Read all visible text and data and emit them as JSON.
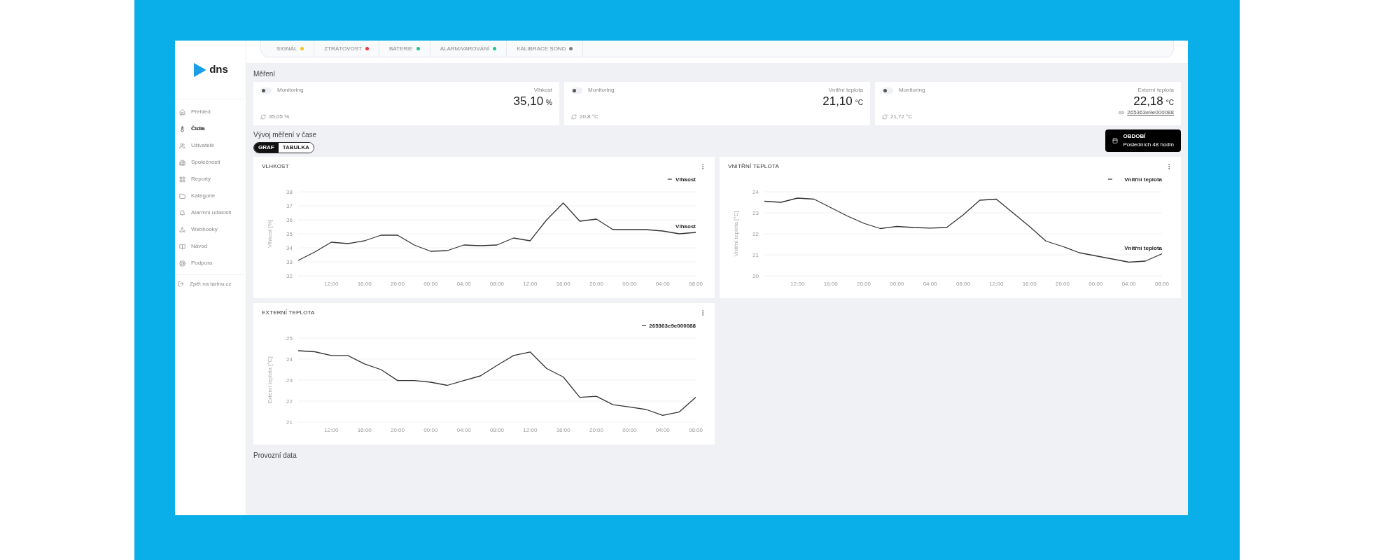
{
  "logo": {
    "text": "dns"
  },
  "sidebar": {
    "items": [
      {
        "label": "Přehled",
        "selected": false
      },
      {
        "label": "Čidla",
        "selected": true
      },
      {
        "label": "Uživatelé",
        "selected": false
      },
      {
        "label": "Společnosti",
        "selected": false
      },
      {
        "label": "Reporty",
        "selected": false
      },
      {
        "label": "Kategorie",
        "selected": false
      },
      {
        "label": "Alarmní události",
        "selected": false
      },
      {
        "label": "Webhooky",
        "selected": false
      },
      {
        "label": "Návod",
        "selected": false
      },
      {
        "label": "Podpora",
        "selected": false
      }
    ],
    "back_link": "Zpět na tarinu.cz"
  },
  "status_bar": [
    {
      "label": "SIGNÁL",
      "color": "#f5c518"
    },
    {
      "label": "ZTRÁTOVOST",
      "color": "#ef3b3b"
    },
    {
      "label": "BATERIE",
      "color": "#1ec98a"
    },
    {
      "label": "ALARM/VAROVÁNÍ",
      "color": "#1ec98a"
    },
    {
      "label": "KALIBRACE SOND",
      "color": "#7a7f87"
    }
  ],
  "measurements": {
    "title": "Měření",
    "cards": [
      {
        "toggle_label": "Monitoring",
        "on": false,
        "label": "Vlhkost",
        "value": "35,10",
        "unit": "%",
        "previous": "35,05 %"
      },
      {
        "toggle_label": "Monitoring",
        "on": false,
        "label": "Vnitřní teplota",
        "value": "21,10",
        "unit": "°C",
        "previous": "20,8 °C"
      },
      {
        "toggle_label": "Monitoring",
        "on": false,
        "label": "Externí teplota",
        "value": "22,18",
        "unit": "°C",
        "previous": "21,72 °C",
        "link": "265363e9e000088"
      }
    ]
  },
  "history": {
    "title": "Vývoj měření v čase",
    "tabs": [
      {
        "label": "GRAF",
        "selected": true
      },
      {
        "label": "TABULKA",
        "selected": false
      }
    ],
    "period": {
      "label": "OBDOBÍ",
      "value": "Posledních 48 hodin"
    },
    "charts": [
      {
        "title": "VLHKOST",
        "chart_data": {
          "type": "line",
          "ylabel": "Vlhkost [%]",
          "categories": [
            null,
            null,
            "12:00",
            null,
            "16:00",
            null,
            "20:00",
            null,
            "00:00",
            null,
            "04:00",
            null,
            "08:00",
            null,
            "12:00",
            null,
            "16:00",
            null,
            "20:00",
            null,
            "00:00",
            null,
            "04:00",
            null,
            "08:00"
          ],
          "series": [
            {
              "name": "Vlhkost",
              "color": "#333333",
              "values": [
                33.1,
                33.7,
                34.4,
                34.3,
                34.5,
                34.9,
                34.9,
                34.2,
                33.75,
                33.8,
                34.2,
                34.15,
                34.2,
                34.7,
                34.5,
                36.0,
                37.2,
                35.9,
                36.05,
                35.3,
                35.3,
                35.3,
                35.2,
                35.0,
                35.1
              ]
            }
          ],
          "ylim": [
            32,
            38
          ],
          "grid": true,
          "yticks": [
            32,
            33,
            34,
            35,
            36,
            37,
            38
          ],
          "annotations": [
            "Vlhkost"
          ]
        }
      },
      {
        "title": "VNITŘNÍ TEPLOTA",
        "chart_data": {
          "type": "line",
          "ylabel": "Vnitřní teplota [°C]",
          "categories": [
            null,
            null,
            "12:00",
            null,
            "16:00",
            null,
            "20:00",
            null,
            "00:00",
            null,
            "04:00",
            null,
            "08:00",
            null,
            "12:00",
            null,
            "16:00",
            null,
            "20:00",
            null,
            "00:00",
            null,
            "04:00",
            null,
            "08:00"
          ],
          "series": [
            {
              "name": "Vnitřní teplota",
              "color": "#333333",
              "values": [
                23.55,
                23.5,
                23.7,
                23.65,
                23.25,
                22.85,
                22.5,
                22.25,
                22.35,
                22.3,
                22.27,
                22.3,
                22.9,
                23.6,
                23.65,
                23.0,
                22.35,
                21.65,
                21.4,
                21.1,
                20.95,
                20.8,
                20.65,
                20.7,
                21.05
              ]
            }
          ],
          "ylim": [
            20,
            24
          ],
          "grid": true,
          "yticks": [
            20,
            21,
            22,
            23,
            24
          ],
          "annotations": [
            "Vnitřní teplota"
          ]
        }
      },
      {
        "title": "EXTERNÍ TEPLOTA",
        "chart_data": {
          "type": "line",
          "ylabel": "Externí teplota [°C]",
          "categories": [
            null,
            null,
            "12:00",
            null,
            "16:00",
            null,
            "20:00",
            null,
            "00:00",
            null,
            "04:00",
            null,
            "08:00",
            null,
            "12:00",
            null,
            "16:00",
            null,
            "20:00",
            null,
            "00:00",
            null,
            "04:00",
            null,
            "08:00"
          ],
          "series": [
            {
              "name": "265363e9e000088",
              "color": "#333333",
              "values": [
                24.4,
                24.35,
                24.17,
                24.17,
                23.77,
                23.5,
                22.98,
                22.98,
                22.9,
                22.75,
                22.98,
                23.2,
                23.7,
                24.17,
                24.34,
                23.55,
                23.15,
                22.18,
                22.23,
                21.83,
                21.72,
                21.6,
                21.32,
                21.48,
                22.18
              ]
            }
          ],
          "ylim": [
            21,
            25
          ],
          "grid": true,
          "yticks": [
            21,
            22,
            23,
            24,
            25
          ]
        }
      }
    ]
  },
  "operational": {
    "title": "Provozní data"
  }
}
